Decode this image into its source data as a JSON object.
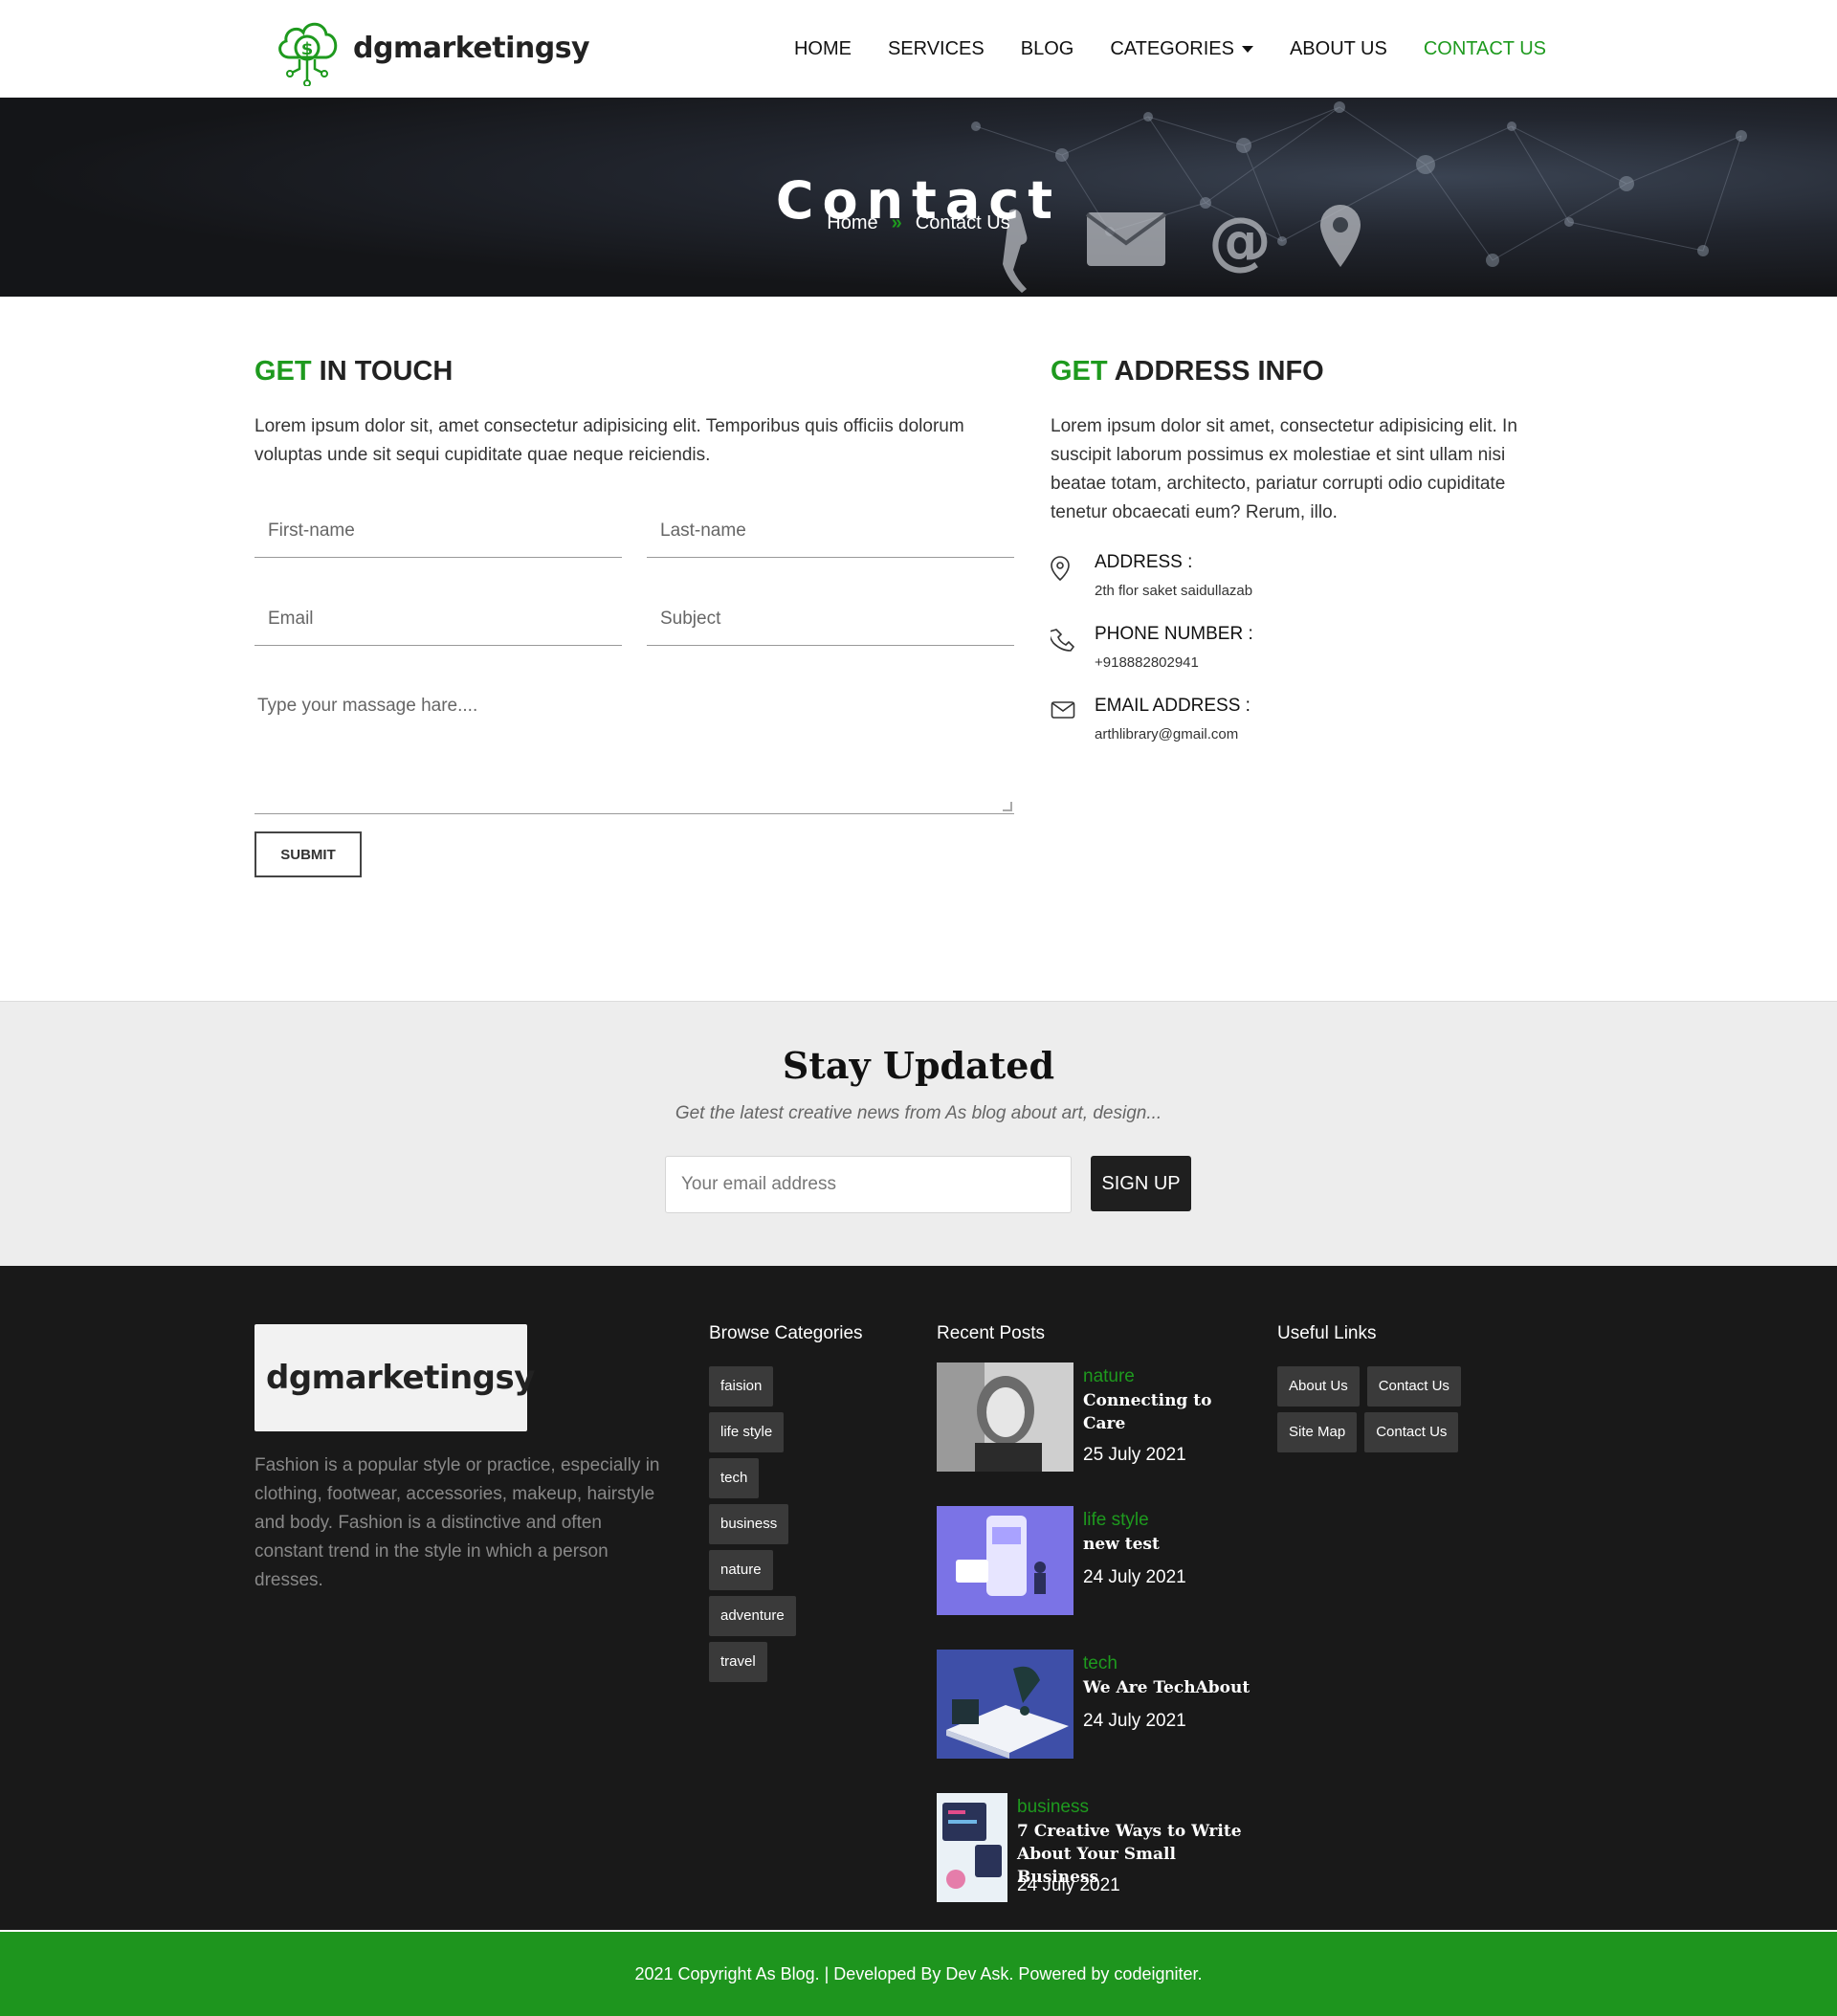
{
  "brand": {
    "name": "dgmarketingsy"
  },
  "nav": {
    "items": [
      {
        "label": "HOME"
      },
      {
        "label": "SERVICES"
      },
      {
        "label": "BLOG"
      },
      {
        "label": "CATEGORIES"
      },
      {
        "label": "ABOUT US"
      },
      {
        "label": "CONTACT US"
      }
    ]
  },
  "hero": {
    "title": "Contact",
    "breadcrumb": {
      "home": "Home",
      "current": "Contact Us"
    }
  },
  "get_in_touch": {
    "title_accent": "GET",
    "title_rest": " IN TOUCH",
    "text": "Lorem ipsum dolor sit, amet consectetur adipisicing elit. Temporibus quis officiis dolorum voluptas unde sit sequi cupiditate quae neque reiciendis.",
    "placeholders": {
      "first_name": "First-name",
      "last_name": "Last-name",
      "email": "Email",
      "subject": "Subject",
      "message": "Type your massage hare...."
    },
    "submit_label": "SUBMIT"
  },
  "address_info": {
    "title_accent": "GET",
    "title_rest": " ADDRESS INFO",
    "text": "Lorem ipsum dolor sit amet, consectetur adipisicing elit. In suscipit laborum possimus ex molestiae et sint ullam nisi beatae totam, architecto, pariatur corrupti odio cupiditate tenetur obcaecati eum? Rerum, illo.",
    "address_label": "ADDRESS :",
    "address_value": "2th flor saket saidullazab",
    "phone_label": "PHONE NUMBER :",
    "phone_value": "+918882802941",
    "email_label": "EMAIL ADDRESS :",
    "email_value": "arthlibrary@gmail.com"
  },
  "newsletter": {
    "title": "Stay Updated",
    "subtitle": "Get the latest creative news from As blog about art, design...",
    "email_placeholder": "Your email address",
    "button": "SIGN UP"
  },
  "footer": {
    "about": "Fashion is a popular style or practice, especially in clothing, footwear, accessories, makeup, hairstyle and body. Fashion is a distinctive and often constant trend in the style in which a person dresses.",
    "categories_title": "Browse Categories",
    "categories": [
      "faision",
      "life style",
      "tech",
      "business",
      "nature",
      "adventure",
      "travel"
    ],
    "recent_title": "Recent Posts",
    "posts": [
      {
        "category": "nature",
        "title": "Connecting to Care",
        "date": "25 July 2021"
      },
      {
        "category": "life style",
        "title": "new test",
        "date": "24 July 2021"
      },
      {
        "category": "tech",
        "title": "We Are TechAbout",
        "date": "24 July 2021"
      },
      {
        "category": "business",
        "title": "7 Creative Ways to Write About Your Small Business",
        "date": "24 July 2021"
      }
    ],
    "links_title": "Useful Links",
    "links": [
      "About Us",
      "Contact Us",
      "Site Map",
      "Contact Us"
    ],
    "copyright": "2021 Copyright As Blog. | Developed By Dev Ask. Powered by codeigniter."
  },
  "colors": {
    "accent": "#1e9a1e",
    "dark": "#191919",
    "copyright_bar": "#1e951e"
  },
  "icons": [
    "cloud-dollar-logo-icon",
    "caret-down-icon",
    "chevron-right-icon",
    "map-pin-icon",
    "phone-icon",
    "envelope-icon"
  ]
}
